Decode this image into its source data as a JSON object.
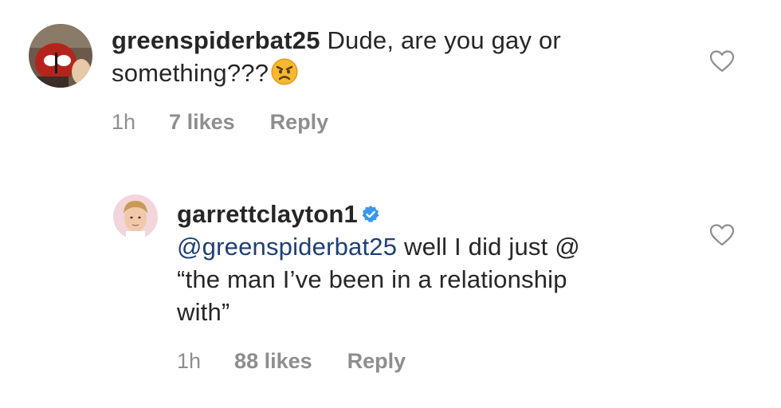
{
  "comments": [
    {
      "username": "greenspiderbat25",
      "text_line1": " Dude, are you gay or",
      "text_line2": "something???",
      "emoji": "angry-face",
      "time": "1h",
      "likes": "7 likes",
      "reply": "Reply",
      "verified": false
    },
    {
      "username": "garrettclayton1",
      "mention": "@greenspiderbat25",
      "text_line1": " well I did just @",
      "text_line2": "“the man I’ve been in a relationship",
      "text_line3": "with”",
      "time": "1h",
      "likes": "88 likes",
      "reply": "Reply",
      "verified": true
    }
  ],
  "colors": {
    "text": "#262626",
    "muted": "#8e8e8e",
    "mention": "#1f3f74",
    "verified": "#3897f0"
  }
}
